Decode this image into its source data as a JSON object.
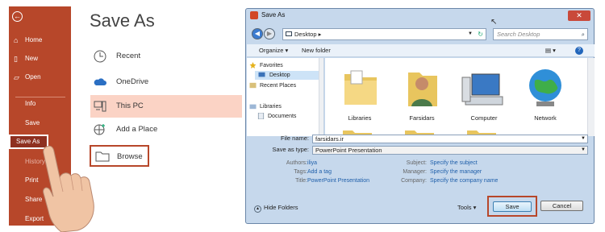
{
  "sidebar": {
    "items": [
      {
        "label": "Home",
        "icon": "home-icon"
      },
      {
        "label": "New",
        "icon": "new-doc-icon"
      },
      {
        "label": "Open",
        "icon": "folder-open-icon"
      },
      {
        "label": "Info"
      },
      {
        "label": "Save"
      },
      {
        "label": "Save As"
      },
      {
        "label": "History"
      },
      {
        "label": "Print"
      },
      {
        "label": "Share"
      },
      {
        "label": "Export"
      }
    ],
    "accent": "#b7472a"
  },
  "saveas": {
    "title": "Save As",
    "locations": [
      {
        "label": "Recent",
        "icon": "clock-icon"
      },
      {
        "label": "OneDrive",
        "icon": "cloud-icon"
      },
      {
        "label": "This PC",
        "icon": "computer-icon"
      },
      {
        "label": "Add a Place",
        "icon": "globe-plus-icon"
      }
    ],
    "browse": {
      "label": "Browse",
      "icon": "folder-icon"
    }
  },
  "dialog": {
    "title": "Save As",
    "close": "✕",
    "address": "Desktop",
    "search_placeholder": "Search Desktop",
    "toolbar": {
      "organize": "Organize ▾",
      "new_folder": "New folder"
    },
    "nav": [
      {
        "label": "Favorites",
        "icon": "star-icon"
      },
      {
        "label": "Desktop",
        "icon": "desktop-icon"
      },
      {
        "label": "Recent Places",
        "icon": "recent-places-icon"
      },
      {
        "label": "Libraries",
        "icon": "libraries-icon"
      },
      {
        "label": "Documents",
        "icon": "documents-icon"
      }
    ],
    "files": [
      {
        "label": "Libraries",
        "icon": "libraries-folder-icon"
      },
      {
        "label": "Farsidars",
        "icon": "user-folder-icon"
      },
      {
        "label": "Computer",
        "icon": "computer-icon"
      },
      {
        "label": "Network",
        "icon": "network-globe-icon"
      }
    ],
    "file_name_label": "File name:",
    "file_name_value": "farsidars.ir",
    "save_type_label": "Save as type:",
    "save_type_value": "PowerPoint Presentation",
    "meta": {
      "authors_label": "Authors:",
      "authors_value": "iliya",
      "tags_label": "Tags:",
      "tags_value": "Add a tag",
      "title_label": "Title:",
      "title_value": "PowerPoint Presentation",
      "subject_label": "Subject:",
      "subject_value": "Specify the subject",
      "manager_label": "Manager:",
      "manager_value": "Specify the manager",
      "company_label": "Company:",
      "company_value": "Specify the company name"
    },
    "hide_folders": "Hide Folders",
    "tools": "Tools",
    "save": "Save",
    "cancel": "Cancel"
  }
}
